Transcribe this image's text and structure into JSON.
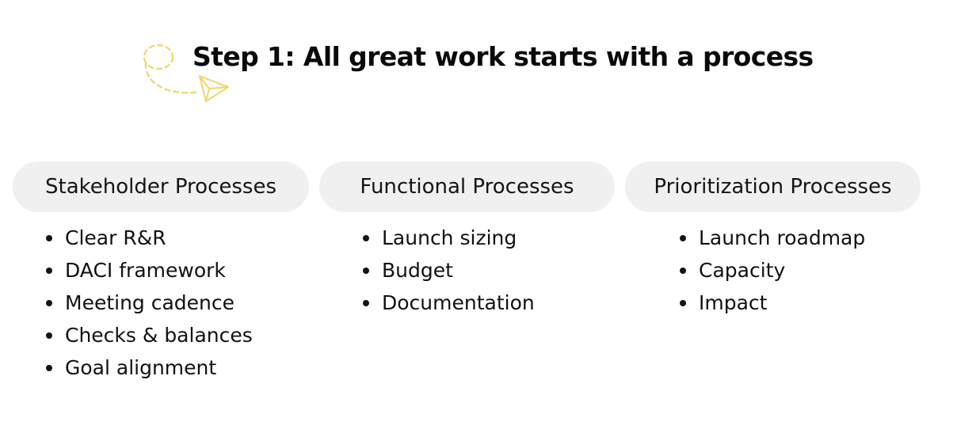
{
  "slide": {
    "title": "Step 1: All great work starts with a process",
    "accent_color": "#f3d774",
    "columns": [
      {
        "heading": "Stakeholder Processes",
        "items": [
          "Clear R&R",
          "DACI framework",
          "Meeting cadence",
          "Checks & balances",
          "Goal alignment"
        ]
      },
      {
        "heading": "Functional Processes",
        "items": [
          "Launch sizing",
          "Budget",
          "Documentation"
        ]
      },
      {
        "heading": "Prioritization Processes",
        "items": [
          "Launch roadmap",
          "Capacity",
          "Impact"
        ]
      }
    ]
  }
}
